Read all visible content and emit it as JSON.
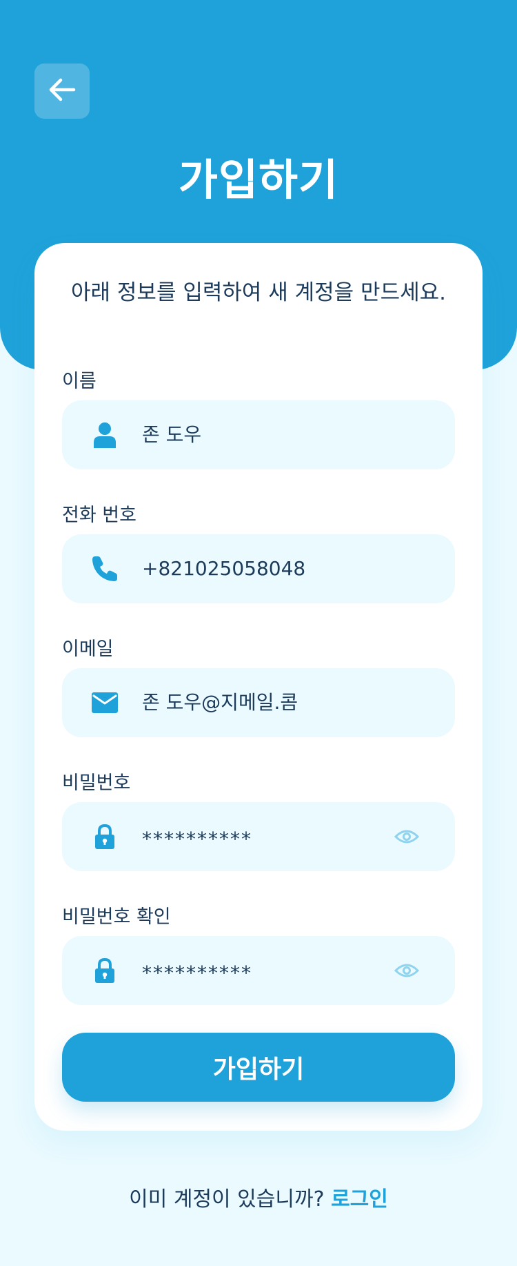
{
  "header": {
    "title": "가입하기",
    "back_icon": "arrow-left-icon"
  },
  "card": {
    "subtitle": "아래 정보를 입력하여 새 계정을 만드세요."
  },
  "fields": {
    "name": {
      "label": "이름",
      "value": "존 도우",
      "icon": "user-icon"
    },
    "phone": {
      "label": "전화 번호",
      "value": "+821025058048",
      "icon": "phone-icon"
    },
    "email": {
      "label": "이메일",
      "value": "존 도우@지메일.콤",
      "icon": "mail-icon"
    },
    "password": {
      "label": "비밀번호",
      "value": "**********",
      "icon": "lock-icon",
      "toggle_icon": "eye-icon"
    },
    "confirm_password": {
      "label": "비밀번호 확인",
      "value": "**********",
      "icon": "lock-icon",
      "toggle_icon": "eye-icon"
    }
  },
  "submit": {
    "label": "가입하기"
  },
  "footer": {
    "prompt": "이미 계정이 있습니까?",
    "login_label": "로그인"
  },
  "colors": {
    "primary": "#1fa2d9",
    "background": "#eafaff",
    "text": "#1c3a5a",
    "icon_light": "#8fd3ef"
  }
}
